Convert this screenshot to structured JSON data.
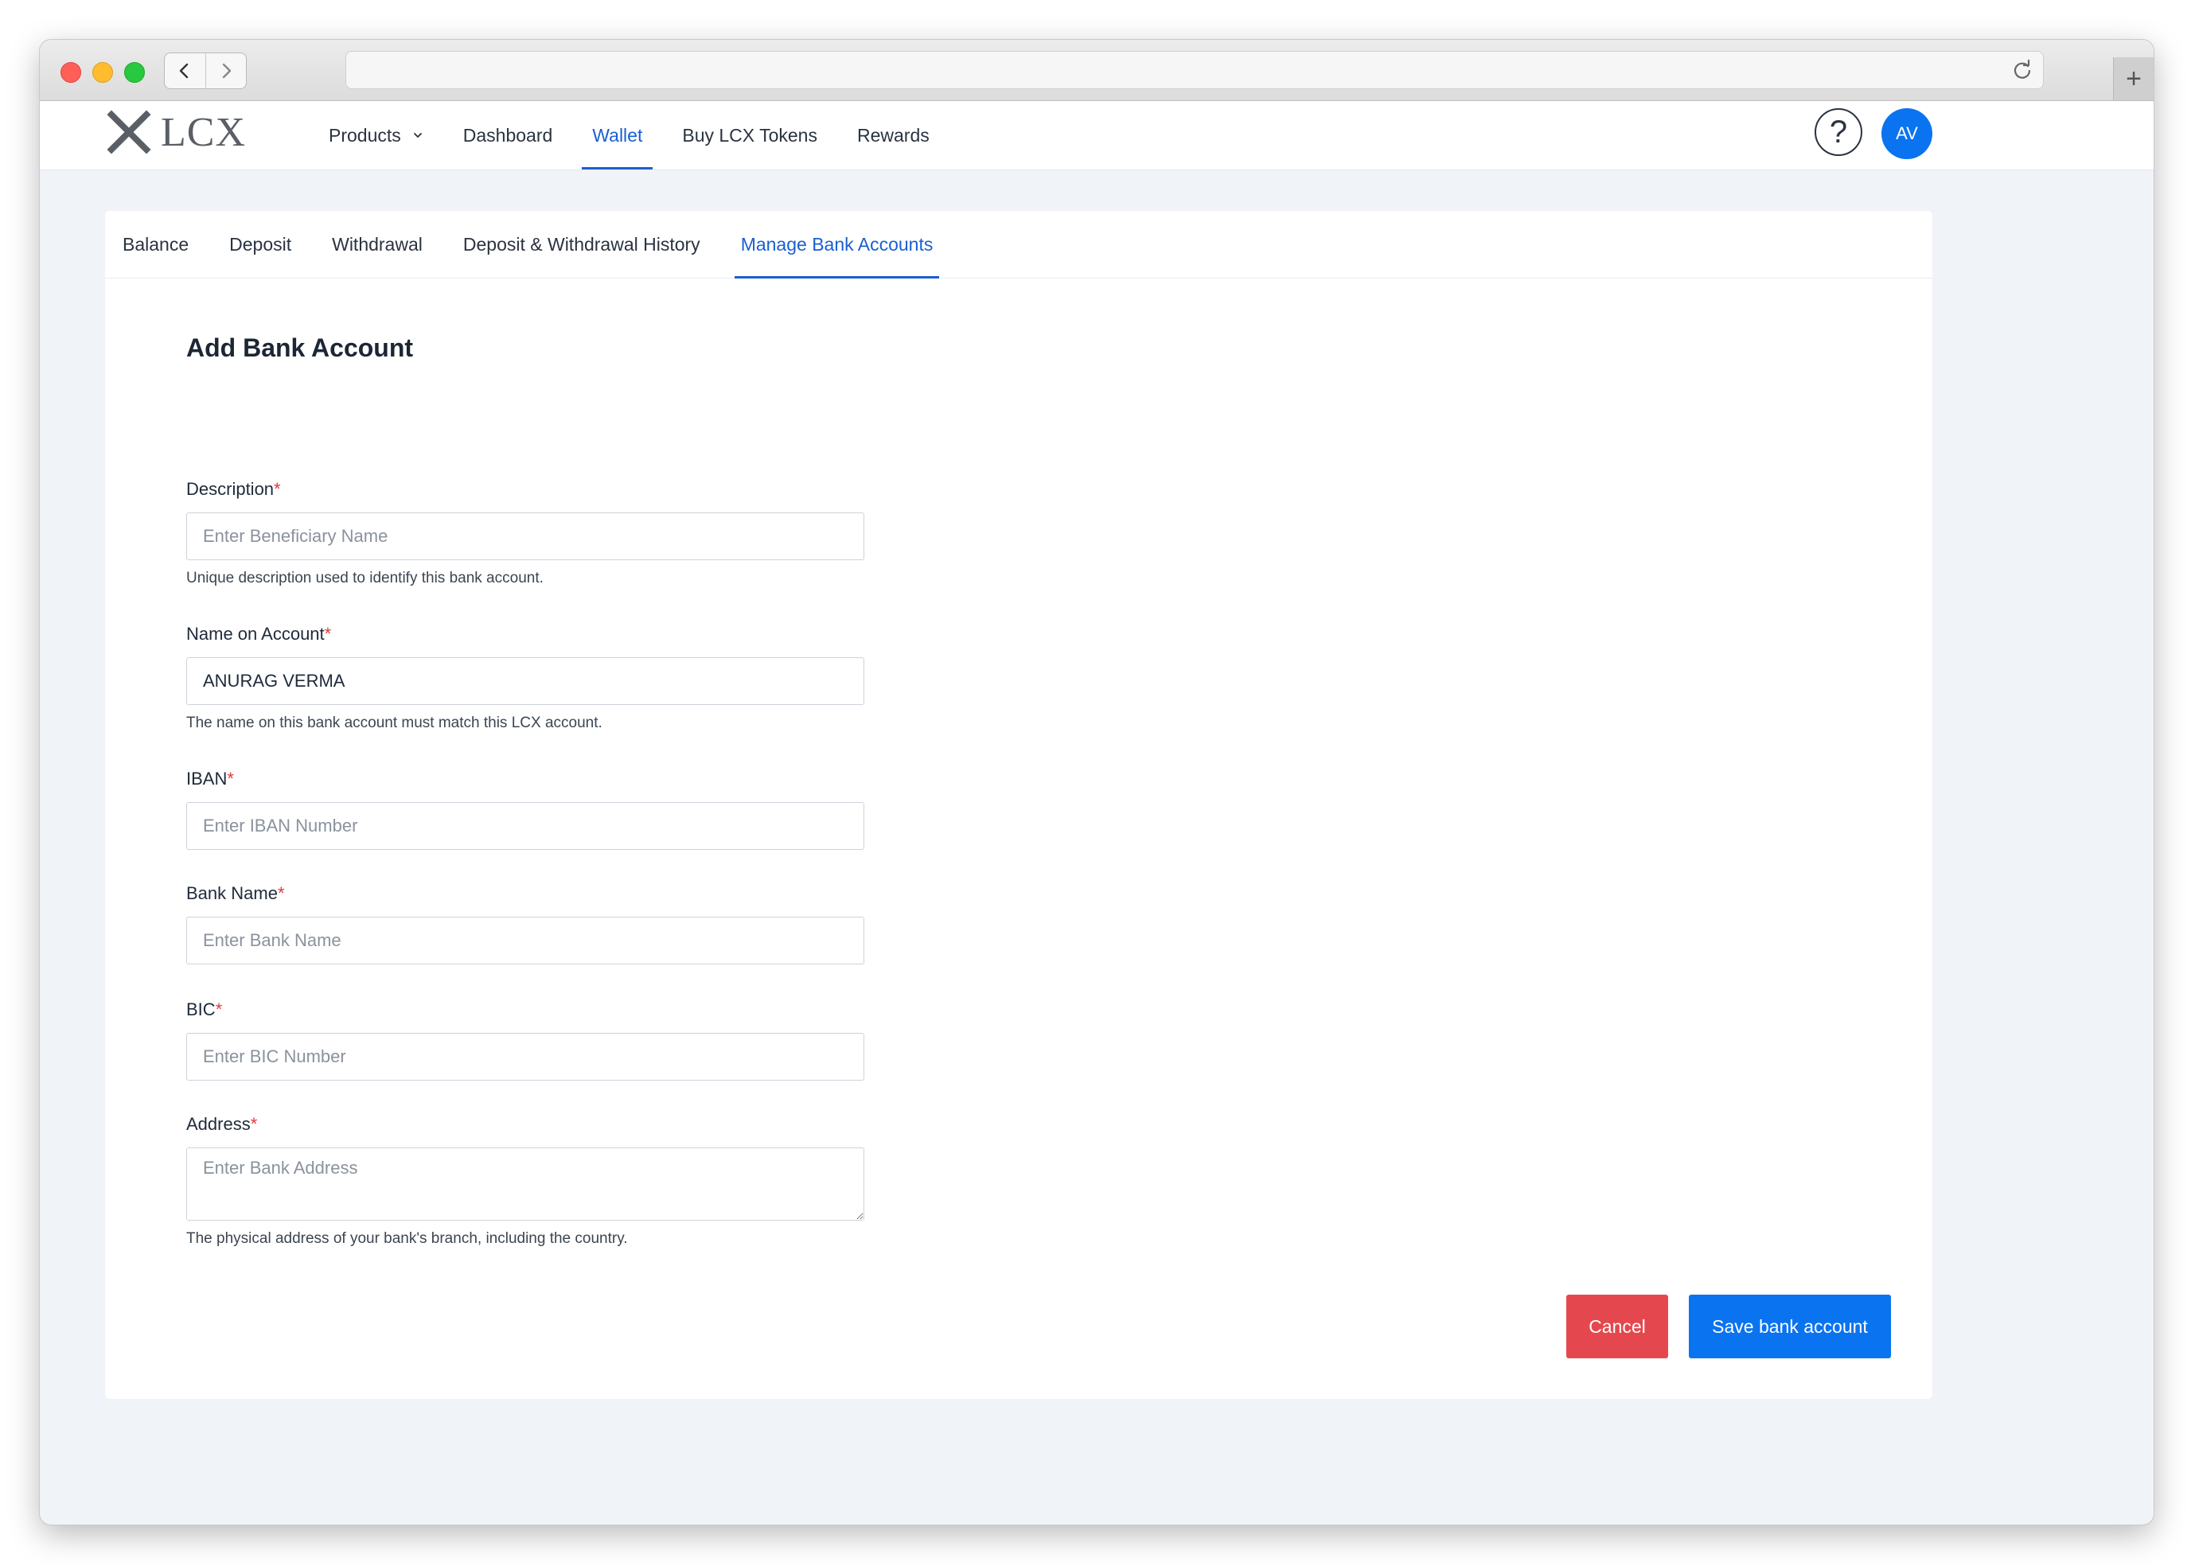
{
  "browser": {
    "url": ""
  },
  "brand": {
    "logo_text": "LCX"
  },
  "main_nav": {
    "items": [
      {
        "label": "Products"
      },
      {
        "label": "Dashboard"
      },
      {
        "label": "Wallet"
      },
      {
        "label": "Buy LCX Tokens"
      },
      {
        "label": "Rewards"
      }
    ],
    "active": "Wallet"
  },
  "header": {
    "help_label": "?",
    "avatar_initials": "AV"
  },
  "sub_tabs": {
    "items": [
      {
        "label": "Balance"
      },
      {
        "label": "Deposit"
      },
      {
        "label": "Withdrawal"
      },
      {
        "label": "Deposit & Withdrawal History"
      },
      {
        "label": "Manage Bank Accounts"
      }
    ],
    "active": "Manage Bank Accounts"
  },
  "form": {
    "title": "Add Bank Account",
    "required_marker": "*",
    "description": {
      "label": "Description",
      "placeholder": "Enter Beneficiary Name",
      "value": "",
      "hint": "Unique description used to identify this bank account."
    },
    "name_on_account": {
      "label": "Name on Account",
      "placeholder": "",
      "value": "ANURAG VERMA",
      "hint": "The name on this bank account must match this LCX account."
    },
    "iban": {
      "label": "IBAN",
      "placeholder": "Enter IBAN Number",
      "value": ""
    },
    "bank_name": {
      "label": "Bank Name",
      "placeholder": "Enter Bank Name",
      "value": ""
    },
    "bic": {
      "label": "BIC",
      "placeholder": "Enter BIC Number",
      "value": ""
    },
    "address": {
      "label": "Address",
      "placeholder": "Enter Bank Address",
      "value": "",
      "hint": "The physical address of your bank's branch, including the country."
    },
    "cancel_label": "Cancel",
    "save_label": "Save bank account"
  },
  "colors": {
    "accent": "#1a5fd1",
    "primary_button": "#0a73f0",
    "danger_button": "#e4484e",
    "page_background": "#f0f3f7"
  },
  "icons": {
    "back": "chevron-left-icon",
    "forward": "chevron-right-icon",
    "reload": "reload-icon",
    "new_tab": "plus-icon",
    "logo": "lcx-logo-icon",
    "dropdown": "chevron-down-icon",
    "help": "help-icon"
  }
}
